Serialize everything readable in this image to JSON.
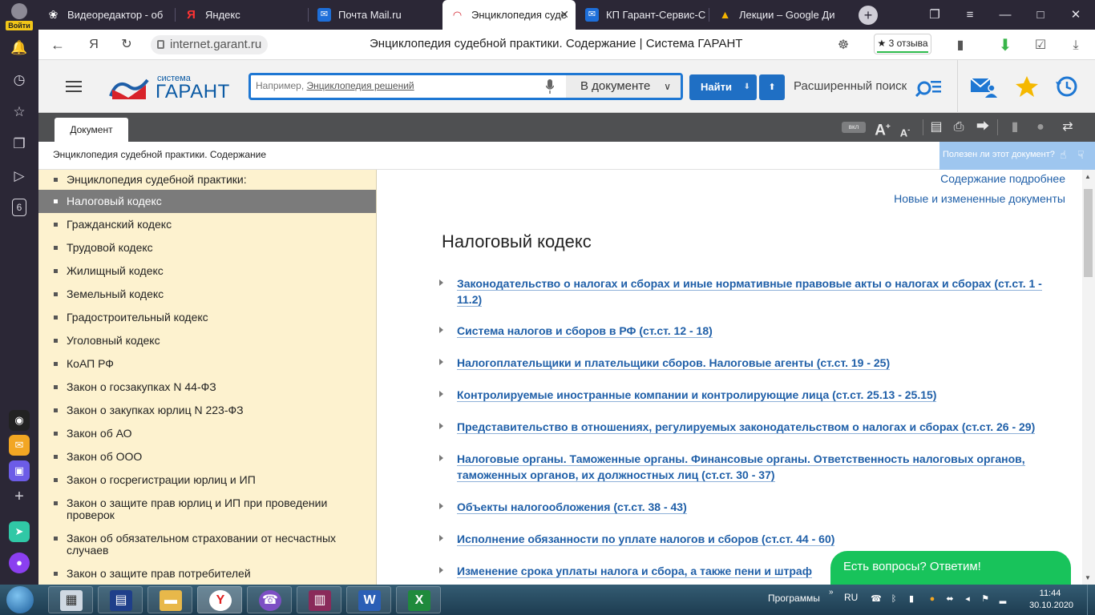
{
  "sidebar": {
    "login_label": "Войти",
    "icons": [
      "bell-icon",
      "history-icon",
      "star-icon",
      "collections-icon",
      "play-icon"
    ],
    "counter": "6"
  },
  "tabs": [
    {
      "label": "Видеоредактор - об",
      "icon": "film-reel-icon"
    },
    {
      "label": "Яндекс",
      "icon": "yandex-icon"
    },
    {
      "label": "Почта Mail.ru",
      "icon": "mail-icon"
    },
    {
      "label": "Энциклопедия суде",
      "icon": "garant-icon",
      "active": true
    },
    {
      "label": "КП Гарант-Сервис-С",
      "icon": "mail-icon"
    },
    {
      "label": "Лекции – Google Ди",
      "icon": "drive-icon"
    }
  ],
  "addressbar": {
    "url": "internet.garant.ru",
    "page_title": "Энциклопедия судебной практики. Содержание | Система ГАРАНТ",
    "reviews": "3 отзыва"
  },
  "header": {
    "logo_small": "система",
    "logo_name": "ГАРАНТ",
    "search_placeholder_prefix": "Например, ",
    "search_placeholder_link": "Энциклопедия решений",
    "scope": "В документе",
    "find_button": "Найти",
    "advanced_search": "Расширенный поиск"
  },
  "toolbar": {
    "doc_tab": "Документ",
    "font_toggle": "вкл"
  },
  "breadcrumb": "Энциклопедия судебной практики. Содержание",
  "useful_prompt": "Полезен ли этот документ?",
  "left_menu": [
    "Энциклопедия судебной практики:",
    "Налоговый кодекс",
    "Гражданский кодекс",
    "Трудовой кодекс",
    "Жилищный кодекс",
    "Земельный кодекс",
    "Градостроительный кодекс",
    "Уголовный кодекс",
    "КоАП РФ",
    "Закон о госзакупках N 44-ФЗ",
    "Закон о закупках юрлиц N 223-ФЗ",
    "Закон об АО",
    "Закон об ООО",
    "Закон о госрегистрации юрлиц и ИП",
    "Закон о защите прав юрлиц и ИП при проведении проверок",
    "Закон об обязательном страховании от несчастных случаев",
    "Закон о защите прав потребителей"
  ],
  "left_menu_selected": 1,
  "main": {
    "link_contents_detailed": "Содержание подробнее",
    "link_new_docs": "Новые и измененные документы",
    "title": "Налоговый кодекс",
    "items": [
      "Законодательство о налогах и сборах и иные нормативные правовые акты о налогах и сборах (ст.ст. 1 - 11.2)",
      "Система налогов и сборов в РФ (ст.ст. 12 - 18)",
      "Налогоплательщики и плательщики сборов. Налоговые агенты (ст.ст. 19 - 25)",
      "Контролируемые иностранные компании и контролирующие лица (ст.ст. 25.13 - 25.15)",
      "Представительство в отношениях, регулируемых законодательством о налогах и сборах (ст.ст. 26 - 29)",
      "Налоговые органы. Таможенные органы. Финансовые органы. Ответственность налоговых органов, таможенных органов, их должностных лиц (ст.ст. 30 - 37)",
      "Объекты налогообложения (ст.ст. 38 - 43)",
      "Исполнение обязанности по уплате налогов и сборов (ст.ст. 44 - 60)",
      "Изменение срока уплаты налога и сбора, а также пени и штраф"
    ]
  },
  "chat": "Есть вопросы? Ответим!",
  "taskbar": {
    "programs": "Программы",
    "lang": "RU",
    "time": "11:44",
    "date": "30.10.2020"
  }
}
